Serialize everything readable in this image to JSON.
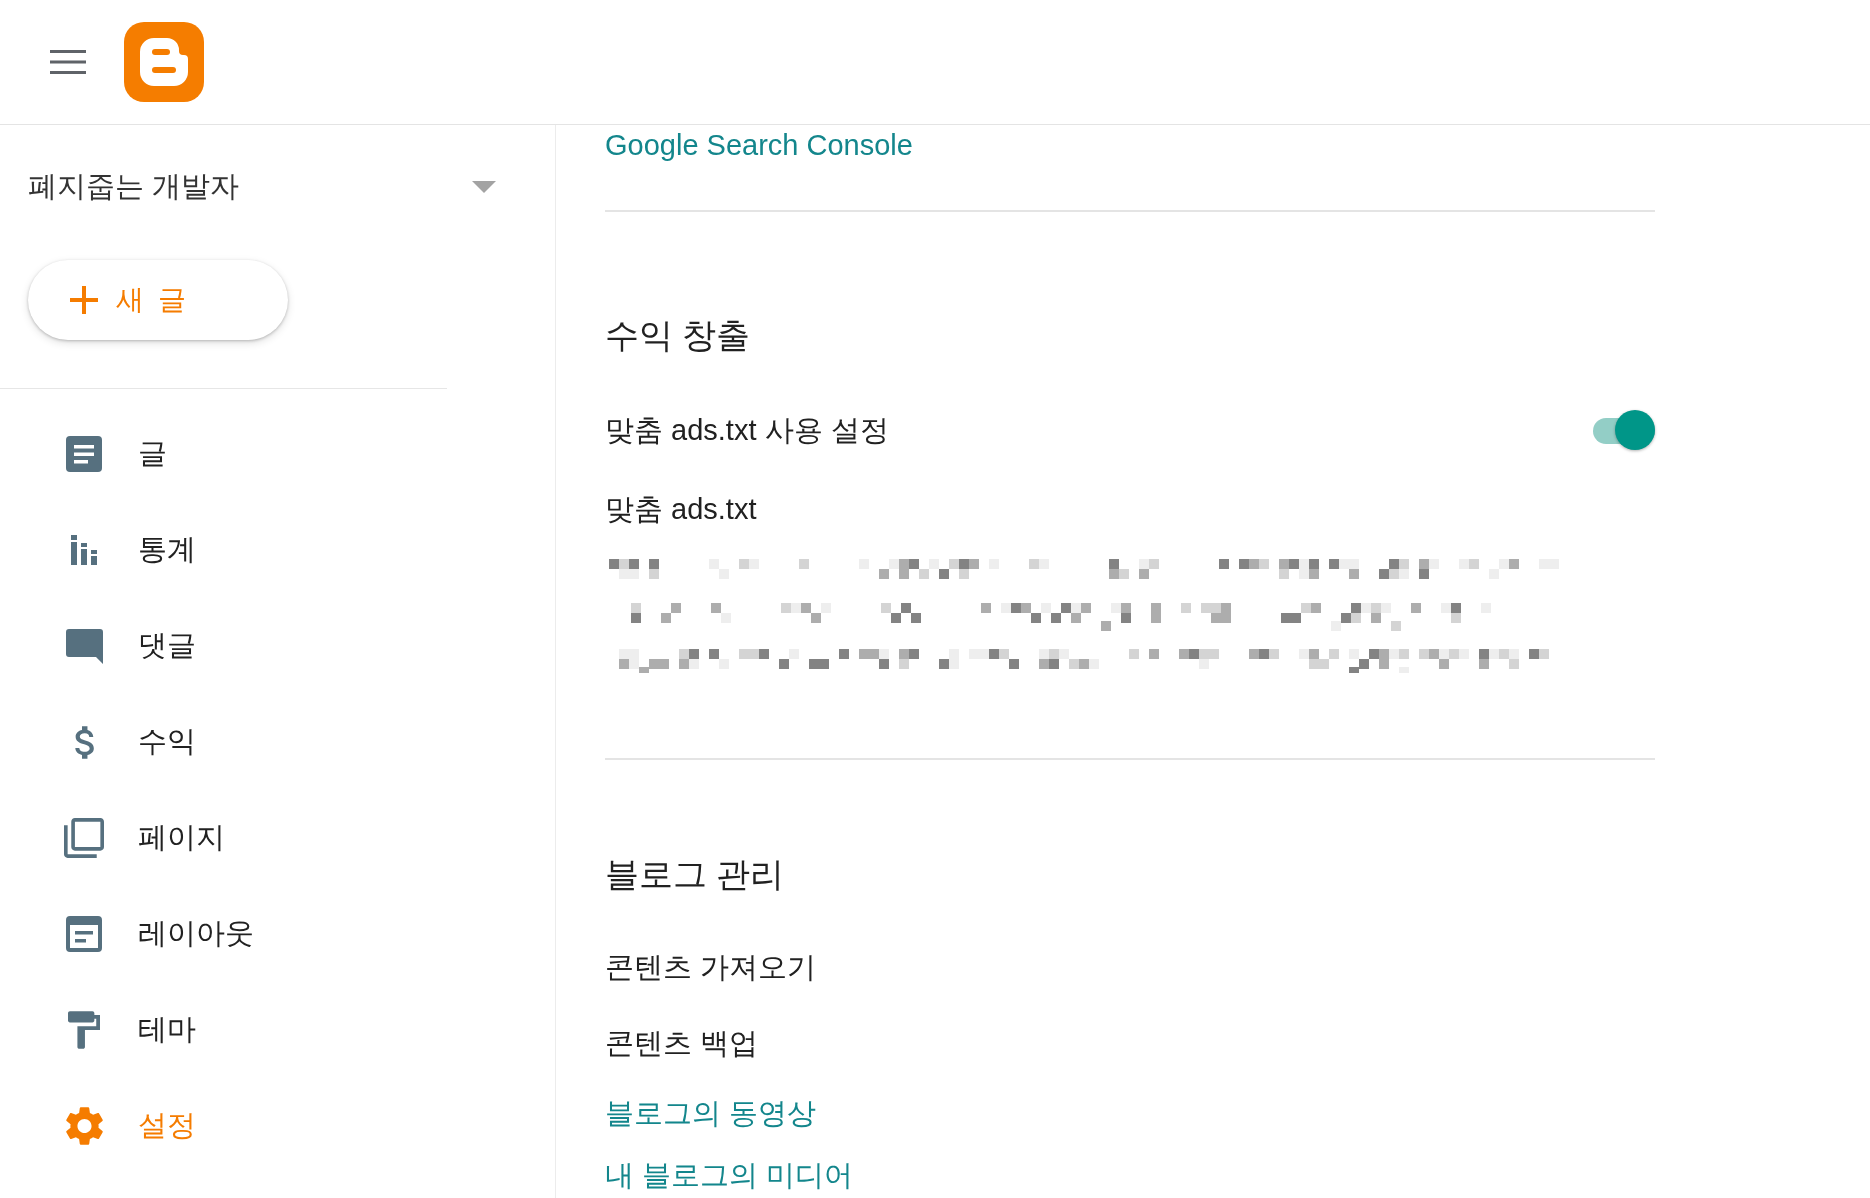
{
  "blog_selector": {
    "name": "폐지줍는 개발자"
  },
  "new_post_button": {
    "label": "새 글"
  },
  "sidebar": {
    "items": [
      {
        "label": "글",
        "selected": false
      },
      {
        "label": "통계",
        "selected": false
      },
      {
        "label": "댓글",
        "selected": false
      },
      {
        "label": "수익",
        "selected": false
      },
      {
        "label": "페이지",
        "selected": false
      },
      {
        "label": "레이아웃",
        "selected": false
      },
      {
        "label": "테마",
        "selected": false
      },
      {
        "label": "설정",
        "selected": true
      }
    ]
  },
  "settings": {
    "sections": [
      {
        "rows": [
          {
            "kind": "link",
            "label": "Google Search Console"
          }
        ]
      },
      {
        "title": "수익 창출",
        "rows": [
          {
            "kind": "toggle",
            "label": "맞춤 ads.txt 사용 설정",
            "on": true
          },
          {
            "kind": "text",
            "label": "맞춤 ads.txt"
          },
          {
            "kind": "redacted"
          }
        ]
      },
      {
        "title": "블로그 관리",
        "rows": [
          {
            "kind": "text",
            "label": "콘텐츠 가져오기"
          },
          {
            "kind": "text",
            "label": "콘텐츠 백업"
          },
          {
            "kind": "link",
            "label": "블로그의 동영상"
          },
          {
            "kind": "link",
            "label": "내 블로그의 미디어"
          }
        ]
      }
    ]
  }
}
